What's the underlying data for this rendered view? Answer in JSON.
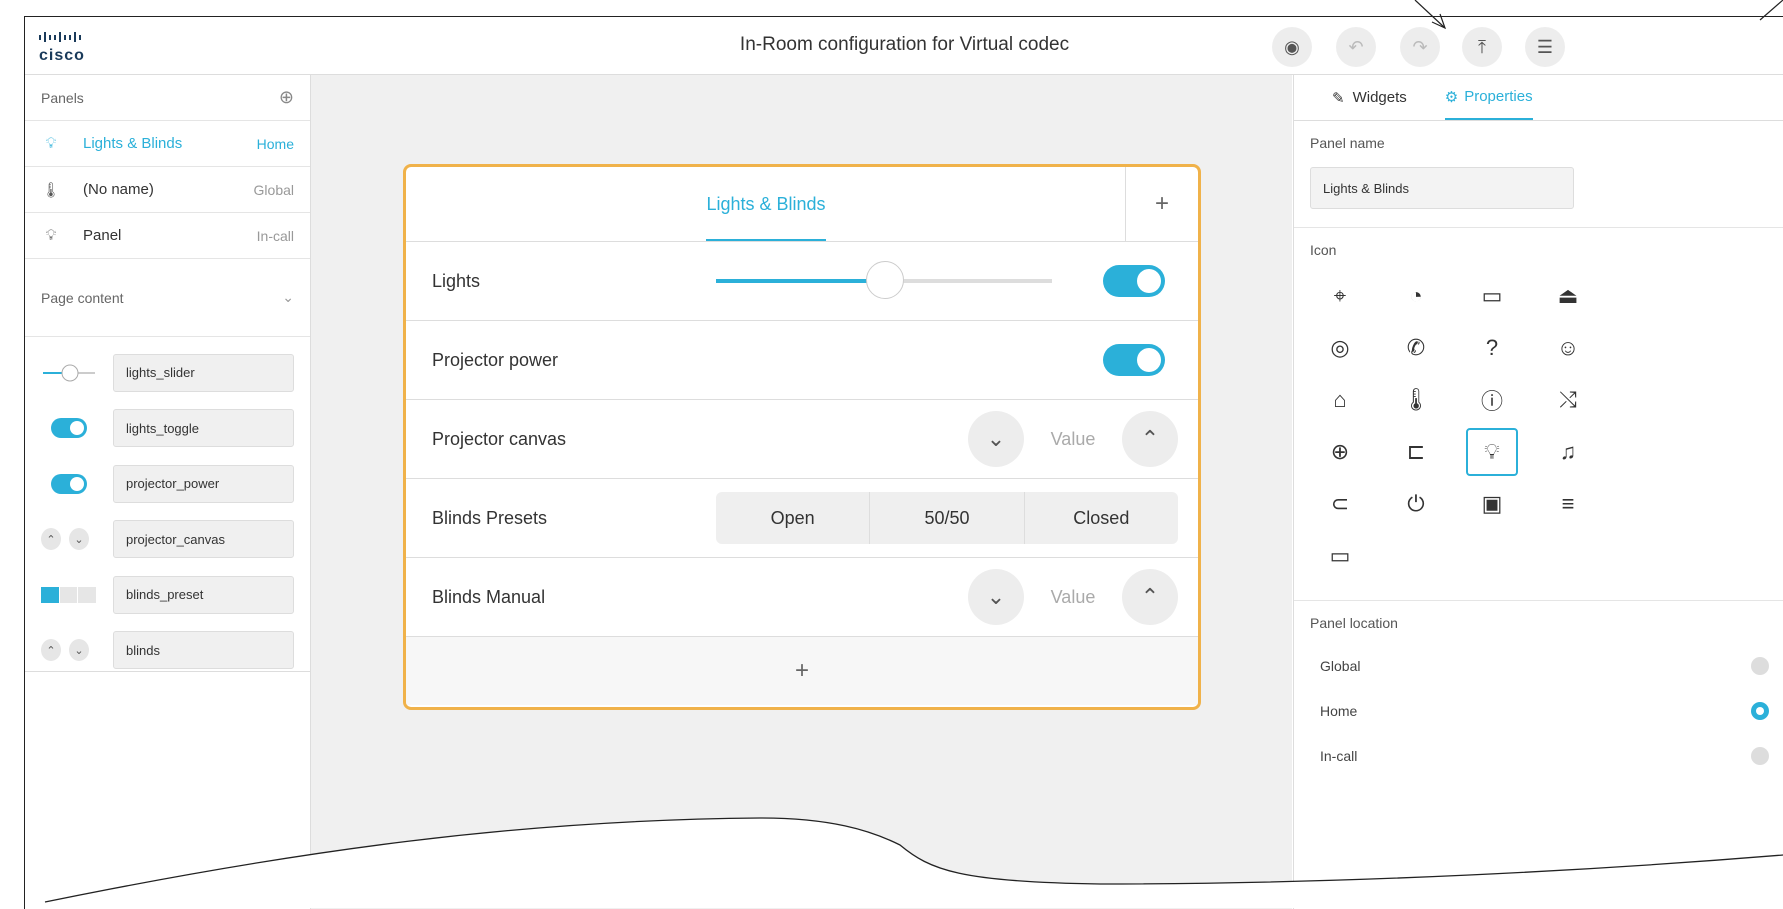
{
  "header": {
    "brand": "cisco",
    "title": "In-Room configuration for Virtual codec"
  },
  "left": {
    "panels_label": "Panels",
    "panels": [
      {
        "name": "Lights & Blinds",
        "location": "Home",
        "icon": "bulb-icon",
        "active": true
      },
      {
        "name": "(No name)",
        "location": "Global",
        "icon": "thermometer-icon",
        "active": false
      },
      {
        "name": "Panel",
        "location": "In-call",
        "icon": "bulb-icon",
        "active": false
      }
    ],
    "page_content_label": "Page content",
    "widgets": [
      {
        "name": "lights_slider",
        "kind": "slider"
      },
      {
        "name": "lights_toggle",
        "kind": "toggle"
      },
      {
        "name": "projector_power",
        "kind": "toggle"
      },
      {
        "name": "projector_canvas",
        "kind": "spinner"
      },
      {
        "name": "blinds_preset",
        "kind": "group"
      },
      {
        "name": "blinds",
        "kind": "spinner"
      }
    ]
  },
  "card": {
    "tab": "Lights & Blinds",
    "rows": {
      "lights": {
        "label": "Lights",
        "slider_value": 0.5,
        "toggle_on": true
      },
      "projector_power": {
        "label": "Projector power",
        "toggle_on": true
      },
      "projector_canvas": {
        "label": "Projector canvas",
        "value": "Value"
      },
      "blinds_presets": {
        "label": "Blinds Presets",
        "options": [
          "Open",
          "50/50",
          "Closed"
        ]
      },
      "blinds_manual": {
        "label": "Blinds Manual",
        "value": "Value"
      }
    }
  },
  "right": {
    "tabs": [
      "Widgets",
      "Properties"
    ],
    "panel_name_label": "Panel name",
    "panel_name_value": "Lights & Blinds",
    "icon_label": "Icon",
    "icons": [
      "briefcase-icon",
      "clock-icon",
      "camera-icon",
      "food-icon",
      "disc-icon",
      "phone-icon",
      "help-icon",
      "concierge-icon",
      "home-icon",
      "thermometer-icon",
      "info-icon",
      "shuffle-icon",
      "globe-icon",
      "laptop-icon",
      "bulb-icon",
      "music-icon",
      "microphone-icon",
      "power-icon",
      "record-icon",
      "sliders-icon",
      "display-icon"
    ],
    "selected_icon": "bulb-icon",
    "panel_location_label": "Panel location",
    "locations": [
      {
        "name": "Global",
        "selected": false
      },
      {
        "name": "Home",
        "selected": true
      },
      {
        "name": "In-call",
        "selected": false
      }
    ]
  },
  "colors": {
    "accent": "#2bb0d9",
    "highlight": "#f0b24a"
  }
}
